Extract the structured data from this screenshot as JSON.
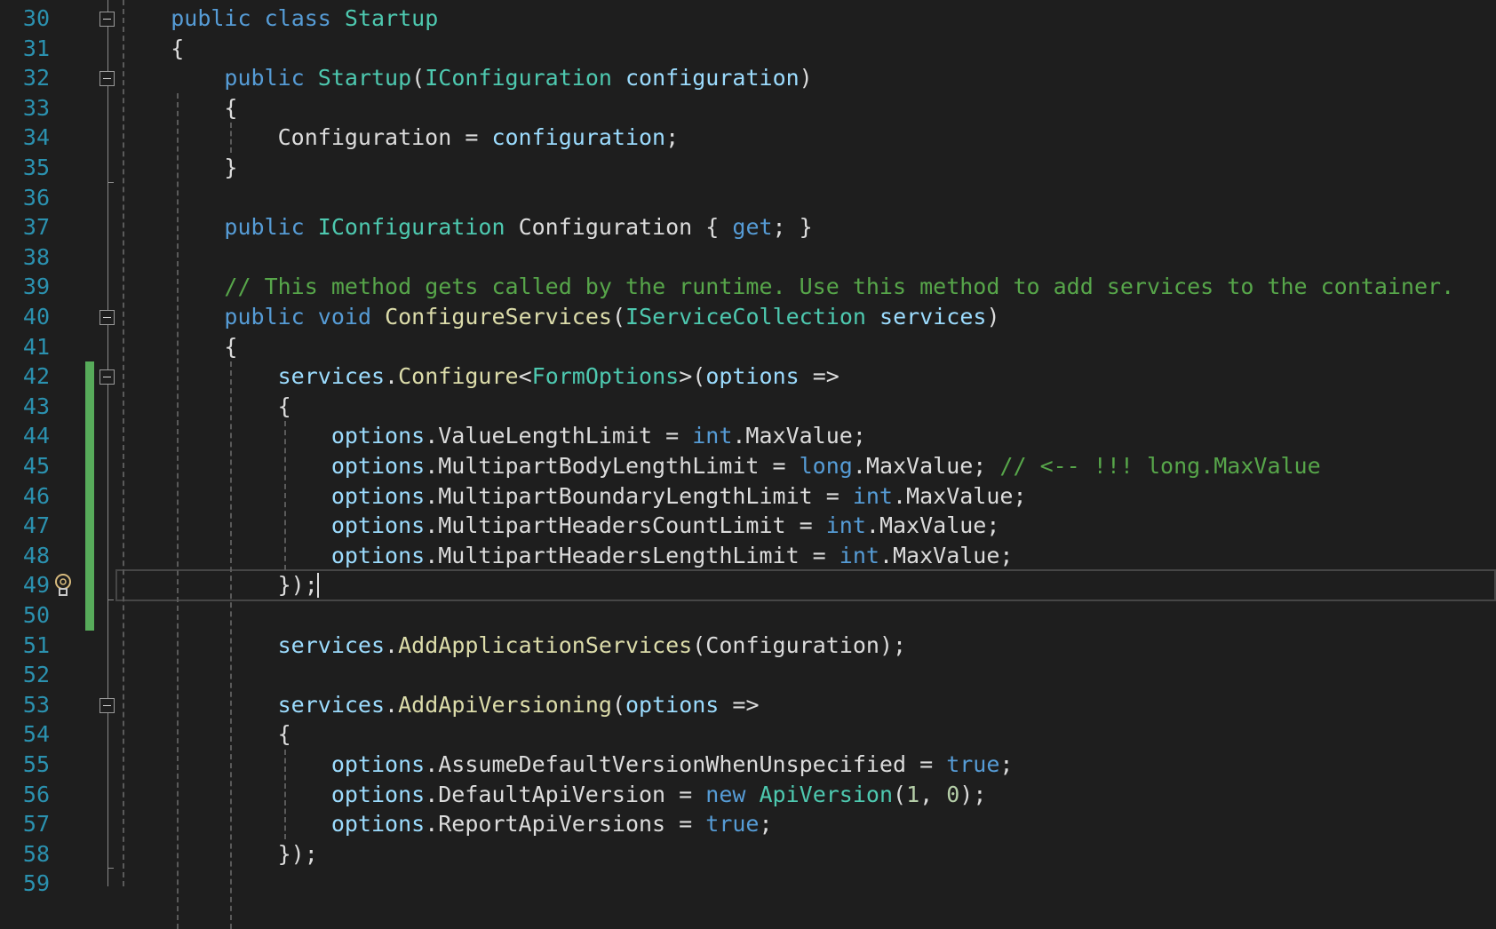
{
  "editor": {
    "theme_colors": {
      "background": "#1e1e1e",
      "keyword": "#569cd6",
      "type": "#4ec9b0",
      "method": "#dcdcaa",
      "variable": "#9cdcfe",
      "comment": "#57a64a",
      "line_number": "#2b91af",
      "changed_marker": "#57ab5a"
    },
    "current_line": 49,
    "changed_lines": [
      42,
      50
    ],
    "fold_markers": [
      30,
      32,
      40,
      42,
      53
    ],
    "lightbulb_line": 49,
    "lines": [
      {
        "n": "30",
        "tokens": [
          [
            "    ",
            "p"
          ],
          [
            "public",
            "k"
          ],
          [
            " ",
            "p"
          ],
          [
            "class",
            "k"
          ],
          [
            " ",
            "p"
          ],
          [
            "Startup",
            "t"
          ]
        ]
      },
      {
        "n": "31",
        "tokens": [
          [
            "    {",
            "p"
          ]
        ]
      },
      {
        "n": "32",
        "tokens": [
          [
            "        ",
            "p"
          ],
          [
            "public",
            "k"
          ],
          [
            " ",
            "p"
          ],
          [
            "Startup",
            "t"
          ],
          [
            "(",
            "p"
          ],
          [
            "IConfiguration",
            "t"
          ],
          [
            " ",
            "p"
          ],
          [
            "configuration",
            "v"
          ],
          [
            ")",
            "p"
          ]
        ]
      },
      {
        "n": "33",
        "tokens": [
          [
            "        {",
            "p"
          ]
        ]
      },
      {
        "n": "34",
        "tokens": [
          [
            "            Configuration = ",
            "p"
          ],
          [
            "configuration",
            "v"
          ],
          [
            ";",
            "p"
          ]
        ]
      },
      {
        "n": "35",
        "tokens": [
          [
            "        }",
            "p"
          ]
        ]
      },
      {
        "n": "36",
        "tokens": []
      },
      {
        "n": "37",
        "tokens": [
          [
            "        ",
            "p"
          ],
          [
            "public",
            "k"
          ],
          [
            " ",
            "p"
          ],
          [
            "IConfiguration",
            "t"
          ],
          [
            " Configuration { ",
            "p"
          ],
          [
            "get",
            "k"
          ],
          [
            "; }",
            "p"
          ]
        ]
      },
      {
        "n": "38",
        "tokens": []
      },
      {
        "n": "39",
        "tokens": [
          [
            "        ",
            "p"
          ],
          [
            "// This method gets called by the runtime. Use this method to add services to the container.",
            "c"
          ]
        ]
      },
      {
        "n": "40",
        "tokens": [
          [
            "        ",
            "p"
          ],
          [
            "public",
            "k"
          ],
          [
            " ",
            "p"
          ],
          [
            "void",
            "k"
          ],
          [
            " ",
            "p"
          ],
          [
            "ConfigureServices",
            "m"
          ],
          [
            "(",
            "p"
          ],
          [
            "IServiceCollection",
            "t"
          ],
          [
            " ",
            "p"
          ],
          [
            "services",
            "v"
          ],
          [
            ")",
            "p"
          ]
        ]
      },
      {
        "n": "41",
        "tokens": [
          [
            "        {",
            "p"
          ]
        ]
      },
      {
        "n": "42",
        "tokens": [
          [
            "            ",
            "p"
          ],
          [
            "services",
            "v"
          ],
          [
            ".",
            "p"
          ],
          [
            "Configure",
            "m"
          ],
          [
            "<",
            "p"
          ],
          [
            "FormOptions",
            "t"
          ],
          [
            ">(",
            "p"
          ],
          [
            "options",
            "v"
          ],
          [
            " =>",
            "p"
          ]
        ]
      },
      {
        "n": "43",
        "tokens": [
          [
            "            {",
            "p"
          ]
        ]
      },
      {
        "n": "44",
        "tokens": [
          [
            "                ",
            "p"
          ],
          [
            "options",
            "v"
          ],
          [
            ".ValueLengthLimit = ",
            "p"
          ],
          [
            "int",
            "k"
          ],
          [
            ".MaxValue;",
            "p"
          ]
        ]
      },
      {
        "n": "45",
        "tokens": [
          [
            "                ",
            "p"
          ],
          [
            "options",
            "v"
          ],
          [
            ".MultipartBodyLengthLimit = ",
            "p"
          ],
          [
            "long",
            "k"
          ],
          [
            ".MaxValue; ",
            "p"
          ],
          [
            "// <-- !!! long.MaxValue",
            "c"
          ]
        ]
      },
      {
        "n": "46",
        "tokens": [
          [
            "                ",
            "p"
          ],
          [
            "options",
            "v"
          ],
          [
            ".MultipartBoundaryLengthLimit = ",
            "p"
          ],
          [
            "int",
            "k"
          ],
          [
            ".MaxValue;",
            "p"
          ]
        ]
      },
      {
        "n": "47",
        "tokens": [
          [
            "                ",
            "p"
          ],
          [
            "options",
            "v"
          ],
          [
            ".MultipartHeadersCountLimit = ",
            "p"
          ],
          [
            "int",
            "k"
          ],
          [
            ".MaxValue;",
            "p"
          ]
        ]
      },
      {
        "n": "48",
        "tokens": [
          [
            "                ",
            "p"
          ],
          [
            "options",
            "v"
          ],
          [
            ".MultipartHeadersLengthLimit = ",
            "p"
          ],
          [
            "int",
            "k"
          ],
          [
            ".MaxValue;",
            "p"
          ]
        ]
      },
      {
        "n": "49",
        "tokens": [
          [
            "            });",
            "p"
          ]
        ]
      },
      {
        "n": "50",
        "tokens": []
      },
      {
        "n": "51",
        "tokens": [
          [
            "            ",
            "p"
          ],
          [
            "services",
            "v"
          ],
          [
            ".",
            "p"
          ],
          [
            "AddApplicationServices",
            "m"
          ],
          [
            "(Configuration);",
            "p"
          ]
        ]
      },
      {
        "n": "52",
        "tokens": []
      },
      {
        "n": "53",
        "tokens": [
          [
            "            ",
            "p"
          ],
          [
            "services",
            "v"
          ],
          [
            ".",
            "p"
          ],
          [
            "AddApiVersioning",
            "m"
          ],
          [
            "(",
            "p"
          ],
          [
            "options",
            "v"
          ],
          [
            " =>",
            "p"
          ]
        ]
      },
      {
        "n": "54",
        "tokens": [
          [
            "            {",
            "p"
          ]
        ]
      },
      {
        "n": "55",
        "tokens": [
          [
            "                ",
            "p"
          ],
          [
            "options",
            "v"
          ],
          [
            ".AssumeDefaultVersionWhenUnspecified = ",
            "p"
          ],
          [
            "true",
            "k"
          ],
          [
            ";",
            "p"
          ]
        ]
      },
      {
        "n": "56",
        "tokens": [
          [
            "                ",
            "p"
          ],
          [
            "options",
            "v"
          ],
          [
            ".DefaultApiVersion = ",
            "p"
          ],
          [
            "new",
            "k"
          ],
          [
            " ",
            "p"
          ],
          [
            "ApiVersion",
            "t"
          ],
          [
            "(",
            "p"
          ],
          [
            "1",
            "n"
          ],
          [
            ", ",
            "p"
          ],
          [
            "0",
            "n"
          ],
          [
            ");",
            "p"
          ]
        ]
      },
      {
        "n": "57",
        "tokens": [
          [
            "                ",
            "p"
          ],
          [
            "options",
            "v"
          ],
          [
            ".ReportApiVersions = ",
            "p"
          ],
          [
            "true",
            "k"
          ],
          [
            ";",
            "p"
          ]
        ]
      },
      {
        "n": "58",
        "tokens": [
          [
            "            });",
            "p"
          ]
        ]
      },
      {
        "n": "59",
        "tokens": []
      }
    ]
  }
}
